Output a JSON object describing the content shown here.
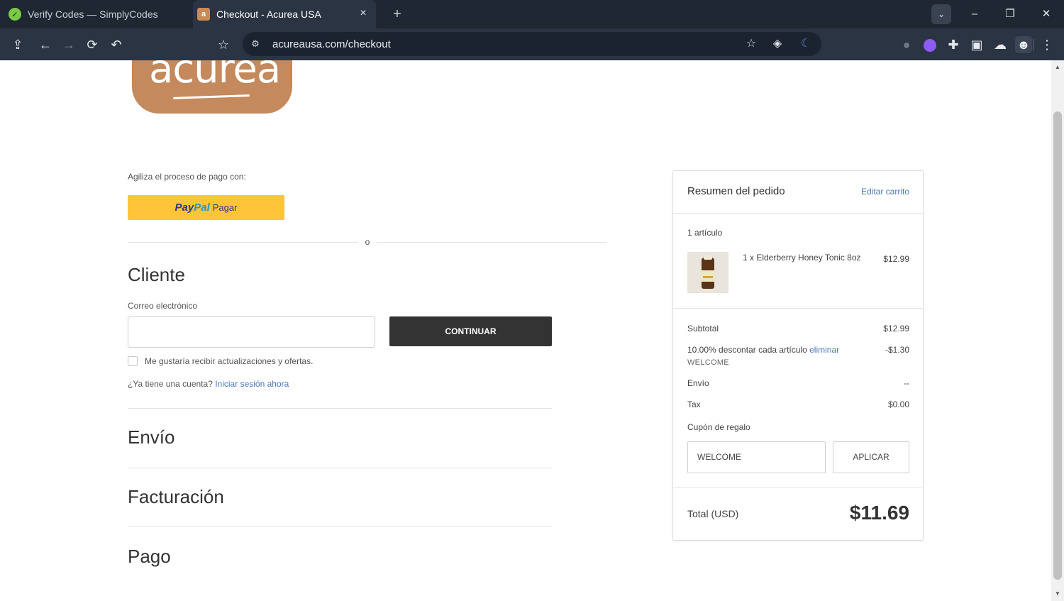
{
  "browser": {
    "tabs": [
      {
        "title": "Verify Codes — SimplyCodes",
        "favicon": "simplycodes-icon"
      },
      {
        "title": "Checkout - Acurea USA",
        "favicon": "acurea-icon",
        "favicon_letter": "a"
      }
    ],
    "address": "acureausa.com/checkout"
  },
  "logo": {
    "text": "acurea"
  },
  "checkout": {
    "express_label": "Agiliza el proceso de pago con:",
    "paypal_pay": "Pay",
    "paypal_pal": "Pal",
    "paypal_label": "Pagar",
    "or_text": "o",
    "customer_title": "Cliente",
    "email_label": "Correo electrónico",
    "email_value": "",
    "continue_label": "CONTINUAR",
    "newsletter_label": "Me gustaría recibir actualizaciones y ofertas.",
    "account_question": "¿Ya tiene una cuenta?",
    "signin_link": "Iniciar sesión ahora",
    "shipping_title": "Envío",
    "billing_title": "Facturación",
    "payment_title": "Pago"
  },
  "summary": {
    "title": "Resumen del pedido",
    "edit_cart": "Editar carrito",
    "item_count": "1 artículo",
    "product_name": "1 x Elderberry Honey Tonic 8oz",
    "product_price": "$12.99",
    "subtotal_label": "Subtotal",
    "subtotal_value": "$12.99",
    "discount_label": "10.00% descontar cada artículo",
    "discount_remove": "eliminar",
    "discount_code": "WELCOME",
    "discount_value": "-$1.30",
    "shipping_label": "Envío",
    "shipping_value": "--",
    "tax_label": "Tax",
    "tax_value": "$0.00",
    "coupon_label": "Cupón de regalo",
    "coupon_value": "WELCOME",
    "apply_label": "APLICAR",
    "total_label": "Total (USD)",
    "total_value": "$11.69"
  }
}
